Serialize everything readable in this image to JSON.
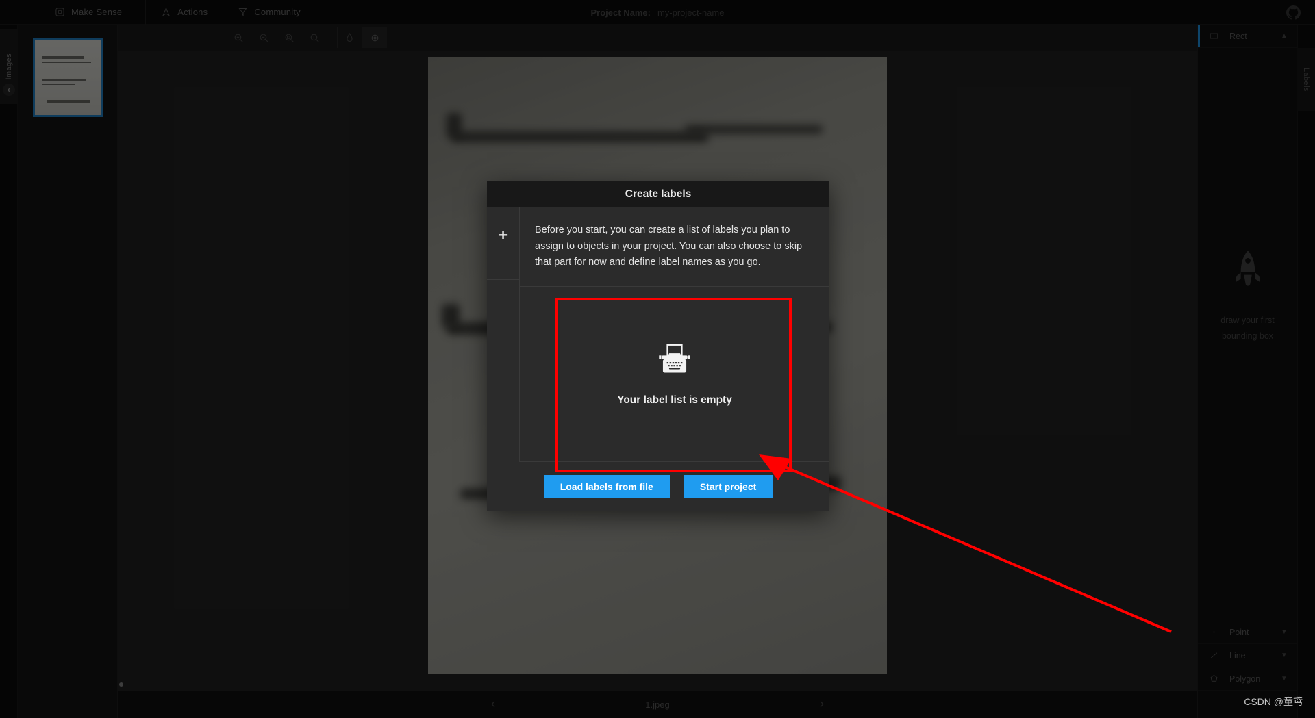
{
  "navbar": {
    "brand": {
      "label": "Make Sense",
      "icon": "logo-icon"
    },
    "items": [
      {
        "label": "Actions",
        "icon": "actions-icon"
      },
      {
        "label": "Community",
        "icon": "community-icon"
      }
    ],
    "project_name_label": "Project Name:",
    "project_name_value": "my-project-name",
    "github_icon": "github-icon"
  },
  "left_rail": {
    "tab_label": "Images",
    "collapse_icon": "chevron-left-icon"
  },
  "image_list": {
    "thumbnail_name": "1.jpeg",
    "selected": true
  },
  "toolbar": {
    "buttons": [
      {
        "name": "zoom-in-icon",
        "title": "Zoom in"
      },
      {
        "name": "zoom-out-icon",
        "title": "Zoom out"
      },
      {
        "name": "zoom-fit-icon",
        "title": "Zoom fit"
      },
      {
        "name": "zoom-max-icon",
        "title": "Zoom max"
      },
      {
        "name": "image-filter-icon",
        "title": "Image filter"
      },
      {
        "name": "crosshair-icon",
        "title": "Crosshair"
      }
    ]
  },
  "bottom_nav": {
    "prev_icon": "chevron-left-icon",
    "next_icon": "chevron-right-icon",
    "file_name": "1.jpeg"
  },
  "right_panel": {
    "rail_tab_label": "Labels",
    "top_sections": [
      {
        "label": "Rect",
        "icon": "rect-icon",
        "chevron": "chevron-up-icon",
        "selected": true
      }
    ],
    "bottom_sections": [
      {
        "label": "Point",
        "icon": "point-icon",
        "chevron": "chevron-down-icon",
        "selected": false
      },
      {
        "label": "Line",
        "icon": "line-icon",
        "chevron": "chevron-down-icon",
        "selected": false
      },
      {
        "label": "Polygon",
        "icon": "polygon-icon",
        "chevron": "chevron-down-icon",
        "selected": false
      }
    ],
    "hint": {
      "icon": "rocket-icon",
      "line1": "draw your first",
      "line2": "bounding box"
    }
  },
  "modal": {
    "title": "Create labels",
    "add_button_label": "+",
    "description": "Before you start, you can create a list of labels you plan to assign to objects in your project. You can also choose to skip that part for now and define label names as you go.",
    "empty_state": {
      "icon": "typewriter-icon",
      "text": "Your label list is empty"
    },
    "buttons": {
      "load": "Load labels from file",
      "start": "Start project"
    }
  },
  "annotation": {
    "highlight_color": "#ff0000",
    "arrow_color": "#ff0000"
  },
  "watermark": "CSDN @童鸢",
  "colors": {
    "accent_blue": "#1f9cf0",
    "selection_blue": "#1c6ea8",
    "modal_bg": "#2b2b2b",
    "app_bg": "#0d0d0d"
  }
}
